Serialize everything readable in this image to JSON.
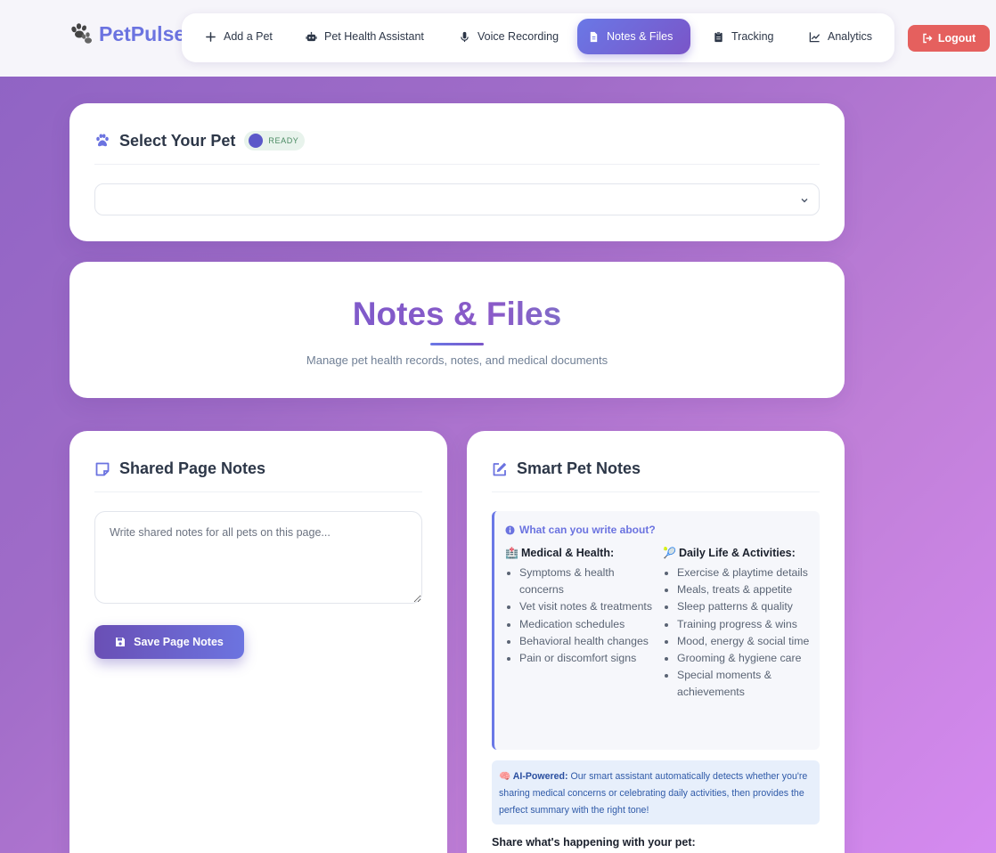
{
  "brand": {
    "name": "PetPulse"
  },
  "nav": {
    "items": [
      {
        "label": "Add a Pet",
        "icon": "plus-icon"
      },
      {
        "label": "Pet Health Assistant",
        "icon": "robot-icon"
      },
      {
        "label": "Voice Recording",
        "icon": "microphone-icon"
      },
      {
        "label": "Notes & Files",
        "icon": "file-icon",
        "active": true
      },
      {
        "label": "Tracking",
        "icon": "clipboard-icon"
      },
      {
        "label": "Analytics",
        "icon": "chart-line-icon"
      }
    ],
    "logout_label": "Logout"
  },
  "pet_select": {
    "title": "Select Your Pet",
    "status": "READY",
    "selected_value": ""
  },
  "hero": {
    "title": "Notes & Files",
    "subtitle": "Manage pet health records, notes, and medical documents"
  },
  "shared_notes": {
    "title": "Shared Page Notes",
    "placeholder": "Write shared notes for all pets on this page...",
    "value": "",
    "save_label": "Save Page Notes"
  },
  "smart_notes": {
    "title": "Smart Pet Notes",
    "info_heading": "What can you write about?",
    "medical": {
      "emoji": "🏥",
      "heading": "Medical & Health:",
      "items": [
        "Symptoms & health concerns",
        "Vet visit notes & treatments",
        "Medication schedules",
        "Behavioral health changes",
        "Pain or discomfort signs"
      ]
    },
    "daily": {
      "emoji": "🎾",
      "heading": "Daily Life & Activities:",
      "items": [
        "Exercise & playtime details",
        "Meals, treats & appetite",
        "Sleep patterns & quality",
        "Training progress & wins",
        "Mood, energy & social time",
        "Grooming & hygiene care",
        "Special moments & achievements"
      ]
    },
    "ai_label": "🧠 AI-Powered:",
    "ai_text": "Our smart assistant automatically detects whether you're sharing medical concerns or celebrating daily activities, then provides the perfect summary with the right tone!",
    "share_label": "Share what's happening with your pet:"
  },
  "colors": {
    "accent": "#6b73e0",
    "active_nav": "#6a78e6",
    "logout": "#e5605e",
    "status_ready_bg": "#e8f3ec",
    "status_ready_text": "#4a8a62"
  }
}
